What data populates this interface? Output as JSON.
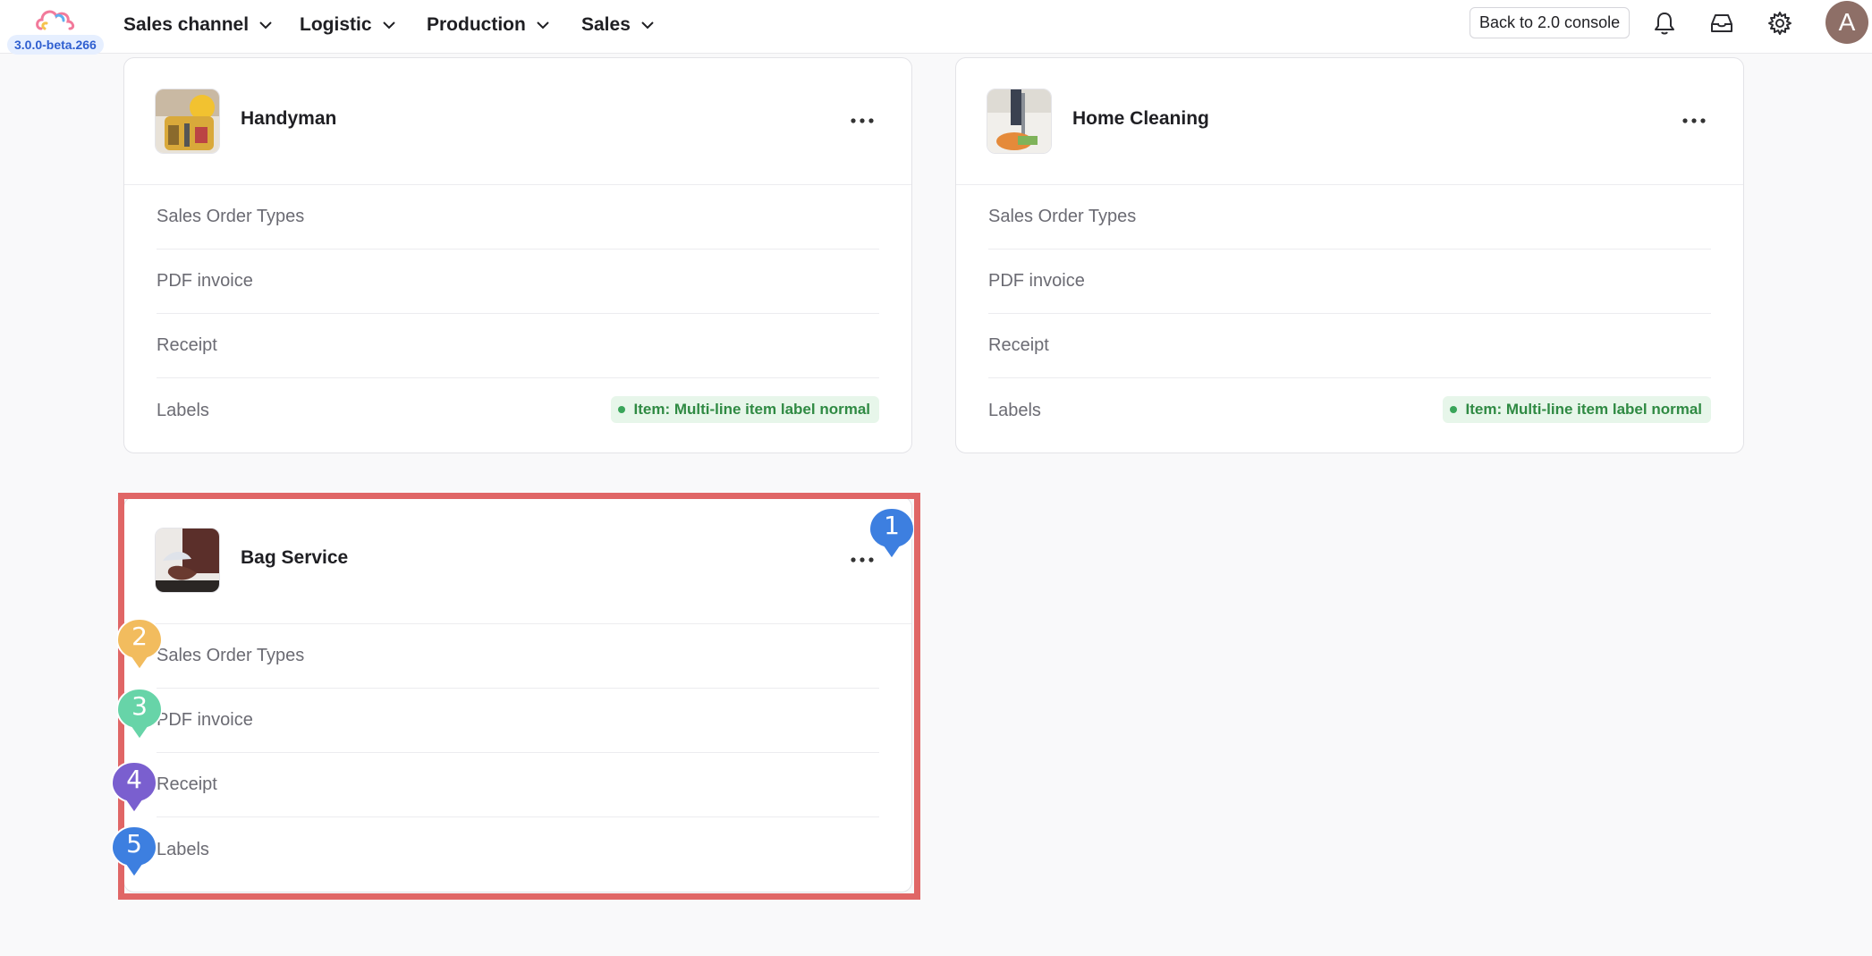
{
  "header": {
    "version": "3.0.0-beta.266",
    "nav": [
      {
        "label": "Sales channel"
      },
      {
        "label": "Logistic"
      },
      {
        "label": "Production"
      },
      {
        "label": "Sales"
      }
    ],
    "back_label": "Back to 2.0 console",
    "avatar_initial": "A",
    "icons": [
      "bell-icon",
      "inbox-icon",
      "gear-icon"
    ]
  },
  "cards": [
    {
      "title": "Handyman",
      "rows": [
        "Sales Order Types",
        "PDF invoice",
        "Receipt",
        "Labels"
      ],
      "tag": "Item: Multi-line item label normal"
    },
    {
      "title": "Home Cleaning",
      "rows": [
        "Sales Order Types",
        "PDF invoice",
        "Receipt",
        "Labels"
      ],
      "tag": "Item: Multi-line item label normal"
    },
    {
      "title": "Bag Service",
      "rows": [
        "Sales Order Types",
        "PDF invoice",
        "Receipt",
        "Labels"
      ]
    }
  ],
  "markers": [
    {
      "number": "1",
      "color": "#3d7fe0"
    },
    {
      "number": "2",
      "color": "#f2bc5e"
    },
    {
      "number": "3",
      "color": "#67d4a8"
    },
    {
      "number": "4",
      "color": "#7a5fcf"
    },
    {
      "number": "5",
      "color": "#3d7fe0"
    }
  ],
  "colors": {
    "highlight": "#e06666",
    "tag_bg": "#e7f6ea",
    "tag_text": "#2f8a43"
  }
}
